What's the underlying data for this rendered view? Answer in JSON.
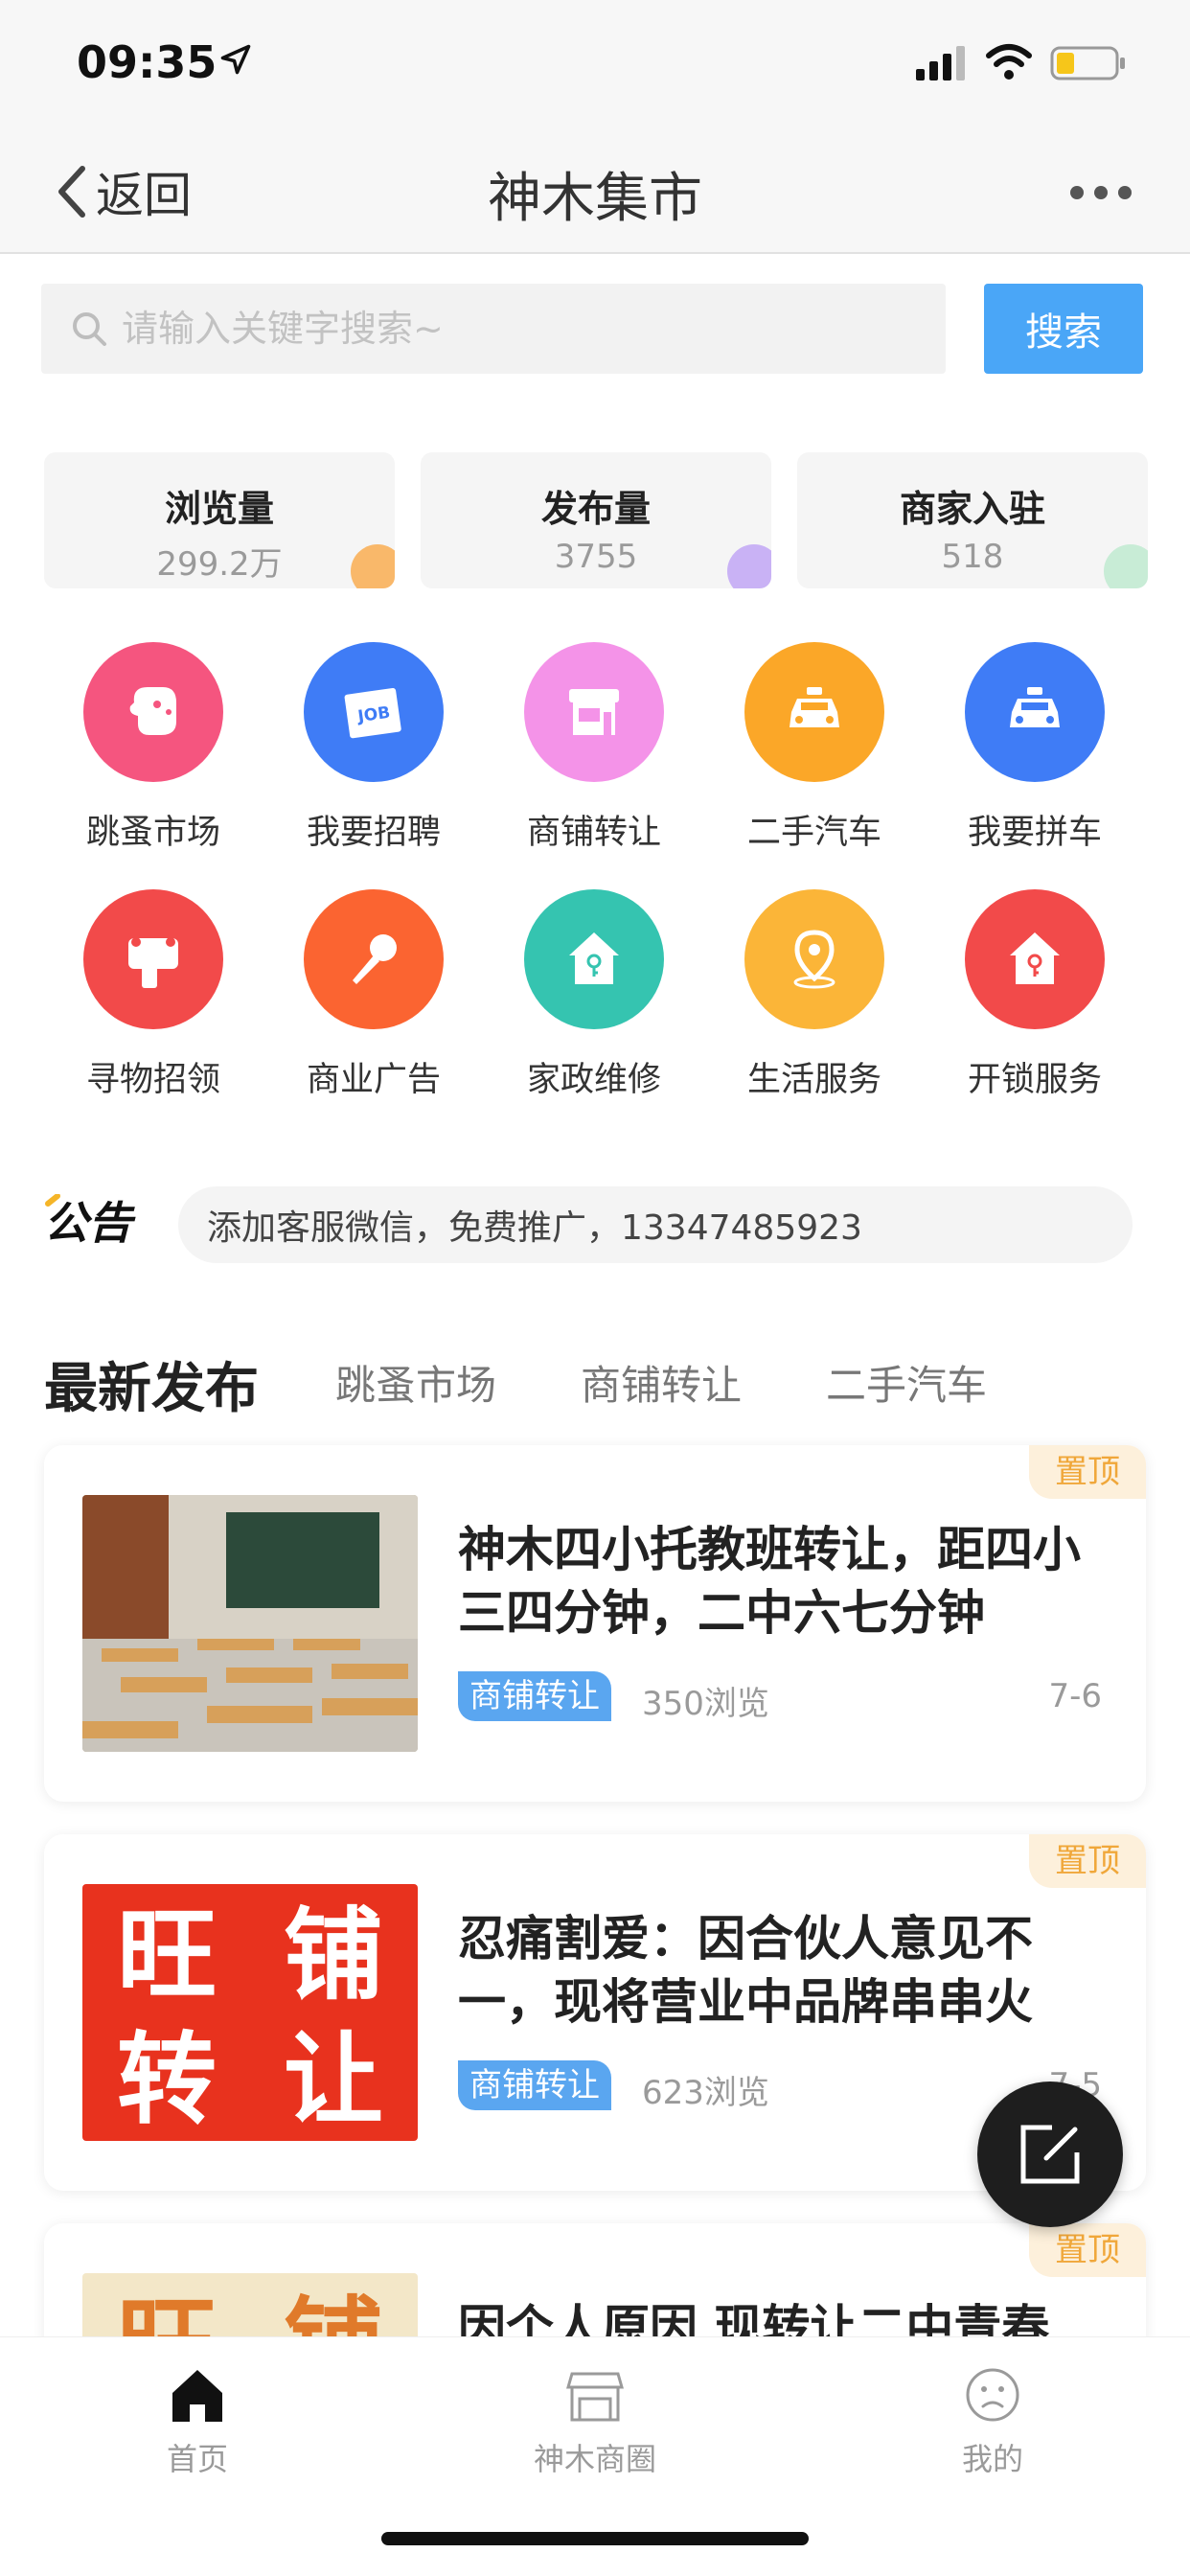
{
  "status_bar": {
    "time": "09:35"
  },
  "nav": {
    "back_label": "返回",
    "title": "神木集市"
  },
  "search": {
    "placeholder": "请输入关键字搜索~",
    "button_label": "搜索"
  },
  "stats": [
    {
      "label": "浏览量",
      "value": "299.2万",
      "color": "#f9b86a"
    },
    {
      "label": "发布量",
      "value": "3755",
      "color": "#c9b2f5"
    },
    {
      "label": "商家入驻",
      "value": "518",
      "color": "#c8ecd6"
    }
  ],
  "categories": [
    {
      "label": "跳蚤市场",
      "icon": "dog-icon",
      "color": "#f5557f"
    },
    {
      "label": "我要招聘",
      "icon": "job-icon",
      "color": "#3f7cf6"
    },
    {
      "label": "商铺转让",
      "icon": "shop-icon",
      "color": "#f493e8"
    },
    {
      "label": "二手汽车",
      "icon": "car-icon",
      "color": "#fba728"
    },
    {
      "label": "我要拼车",
      "icon": "taxi-icon",
      "color": "#3f7cf6"
    },
    {
      "label": "寻物招领",
      "icon": "scroll-icon",
      "color": "#f24a4a"
    },
    {
      "label": "商业广告",
      "icon": "microphone-icon",
      "color": "#fb6431"
    },
    {
      "label": "家政维修",
      "icon": "house-key-icon",
      "color": "#35c4b0"
    },
    {
      "label": "生活服务",
      "icon": "location-pin-icon",
      "color": "#fbb538"
    },
    {
      "label": "开锁服务",
      "icon": "unlock-house-icon",
      "color": "#f24a4a"
    }
  ],
  "notice": {
    "logo_text": "公告",
    "text": "添加客服微信，免费推广，13347485923"
  },
  "tabs": {
    "title": "最新发布",
    "items": [
      "跳蚤市场",
      "商铺转让",
      "二手汽车"
    ]
  },
  "posts": [
    {
      "badge": "置顶",
      "title": "神木四小托教班转让，距四小三四分钟，二中六七分钟",
      "tag": "商铺转让",
      "views": "350浏览",
      "date": "7-6"
    },
    {
      "badge": "置顶",
      "title": "忍痛割爱：因合伙人意见不一，现将营业中品牌串串火",
      "tag": "商铺转让",
      "views": "623浏览",
      "date": "7-5",
      "thumb_text": [
        "旺",
        "铺",
        "转",
        "让"
      ]
    },
    {
      "badge": "置顶",
      "title": "因个人原因 现转让二中青春",
      "thumb_text": [
        "旺",
        "铺"
      ]
    }
  ],
  "tabbar": [
    {
      "label": "首页",
      "icon": "home-icon",
      "active": true
    },
    {
      "label": "神木商圈",
      "icon": "store-icon",
      "active": false
    },
    {
      "label": "我的",
      "icon": "face-icon",
      "active": false
    }
  ]
}
